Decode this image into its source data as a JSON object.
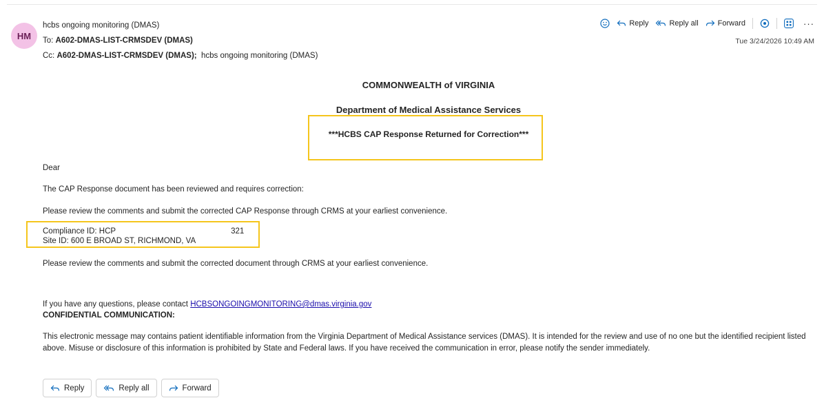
{
  "sender": {
    "initials": "HM",
    "name": "hcbs ongoing monitoring (DMAS)"
  },
  "recipients": {
    "to_label": "To:",
    "to": "A602-DMAS-LIST-CRMSDEV (DMAS)",
    "cc_label": "Cc:",
    "cc_primary": "A602-DMAS-LIST-CRMSDEV (DMAS);",
    "cc_secondary": "hcbs ongoing monitoring (DMAS)"
  },
  "toolbar": {
    "reply_label": "Reply",
    "reply_all_label": "Reply all",
    "forward_label": "Forward",
    "more_label": "···"
  },
  "date": "Tue 3/24/2026 10:49 AM",
  "message": {
    "heading1": "COMMONWEALTH of VIRGINIA",
    "heading2": "Department of Medical Assistance Services",
    "heading3": "***HCBS CAP Response Returned for Correction***",
    "greeting": "Dear",
    "line1": "The CAP Response document has been reviewed and requires correction:",
    "line2": "Please review the comments and submit the corrected CAP Response through CRMS at your earliest convenience.",
    "compliance_label": "Compliance ID: HCP",
    "compliance_suffix": "321",
    "site_id": "Site ID: 600 E BROAD ST, RICHMOND, VA",
    "line3": "Please review the comments and submit the corrected document through CRMS at your earliest convenience.",
    "contact_prefix": "If you have any questions, please contact",
    "contact_email": "HCBSONGOINGMONITORING@dmas.virginia.gov",
    "confidential_heading": "CONFIDENTIAL COMMUNICATION:",
    "confidential_text": "This electronic message may contains patient identifiable information from the Virginia Department of Medical Assistance services (DMAS). It is intended for the review and use of no one but the identified recipient listed above. Misuse or disclosure of this information is prohibited by State and Federal laws. If you have received the communication in error, please notify the sender immediately."
  },
  "footer": {
    "reply_label": "Reply",
    "reply_all_label": "Reply all",
    "forward_label": "Forward"
  },
  "colors": {
    "highlight_box": "#f5c51b",
    "avatar_bg": "#f3c2e6",
    "link": "#1a0dab",
    "accent_icon": "#0f6cbd"
  }
}
